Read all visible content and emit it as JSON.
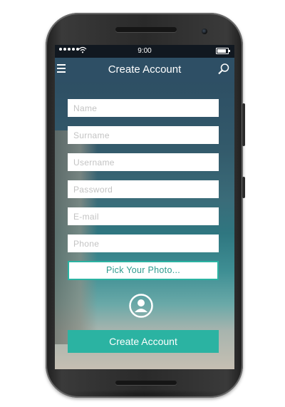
{
  "status_bar": {
    "time": "9:00",
    "signal_icon": "signal-dots-icon",
    "wifi_icon": "wifi-icon",
    "battery_icon": "battery-icon"
  },
  "app_bar": {
    "title": "Create Account",
    "menu_icon": "hamburger-menu-icon",
    "search_icon": "search-icon"
  },
  "form": {
    "fields": [
      {
        "key": "name",
        "placeholder": "Name"
      },
      {
        "key": "surname",
        "placeholder": "Surname"
      },
      {
        "key": "username",
        "placeholder": "Username"
      },
      {
        "key": "password",
        "placeholder": "Password"
      },
      {
        "key": "email",
        "placeholder": "E-mail"
      },
      {
        "key": "phone",
        "placeholder": "Phone"
      }
    ],
    "pick_photo_label": "Pick Your Photo...",
    "avatar_icon": "user-avatar-icon",
    "submit_label": "Create Account"
  },
  "colors": {
    "accent": "#2bb3a2",
    "appbar": "#2f5065",
    "statusbar": "#111820"
  }
}
